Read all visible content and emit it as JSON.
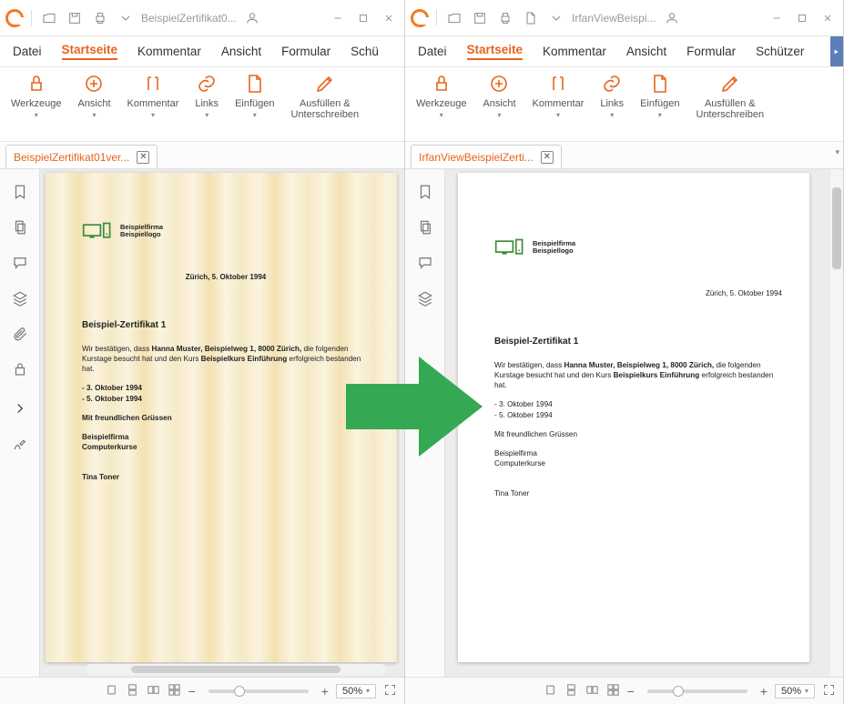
{
  "common": {
    "menu": {
      "datei": "Datei",
      "startseite": "Startseite",
      "kommentar": "Kommentar",
      "ansicht": "Ansicht",
      "formular": "Formular",
      "schutzen_trunc_left": "Schü",
      "schutzen_trunc_right": "Schützer"
    },
    "ribbon": {
      "werkzeuge": "Werkzeuge",
      "ansicht": "Ansicht",
      "kommentar": "Kommentar",
      "links": "Links",
      "einfugen": "Einfügen",
      "ausfullen": "Ausfüllen &\nUnterschreiben"
    },
    "status": {
      "zoom": "50%",
      "minus": "−",
      "plus": "+"
    },
    "logo": {
      "line1": "Beispielfirma",
      "line2": "Beispiellogo"
    },
    "cert": {
      "date": "Zürich, 5. Oktober 1994",
      "title": "Beispiel-Zertifikat 1",
      "p1a": "Wir bestätigen, dass ",
      "p1b": "Hanna Muster, Beispielweg 1, 8000 Zürich,",
      "p1c": " die folgenden Kurstage besucht hat und den Kurs ",
      "p1d": "Beispielkurs Einführung",
      "p1e": " erfolgreich bestanden hat.",
      "d1": "- 3. Oktober 1994",
      "d2": "- 5. Oktober 1994",
      "gruss": "Mit freundlichen Grüssen",
      "f1": "Beispielfirma",
      "f2": "Computerkurse",
      "sign": "Tina Toner"
    }
  },
  "left": {
    "title": "BeispielZertifikat0...",
    "tab": "BeispielZertifikat01ver..."
  },
  "right": {
    "title": "IrfanViewBeispi...",
    "tab": "IrfanViewBeispielZerti..."
  }
}
